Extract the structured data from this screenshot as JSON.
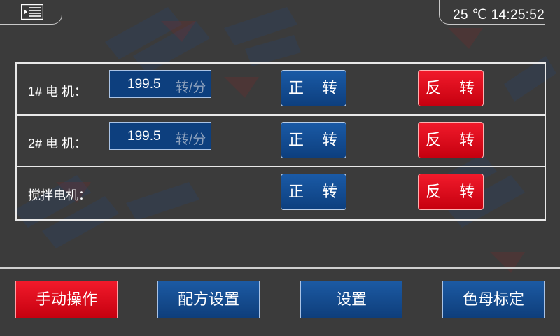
{
  "header": {
    "menu_icon": "menu-list-icon",
    "clock": "25 ℃ 14:25:52"
  },
  "motors": [
    {
      "label": "1# 电 机：",
      "speed_value": "199.5",
      "speed_unit": "转/分",
      "forward_label": "正 转",
      "reverse_label": "反 转"
    },
    {
      "label": "2# 电 机：",
      "speed_value": "199.5",
      "speed_unit": "转/分",
      "forward_label": "正 转",
      "reverse_label": "反 转"
    },
    {
      "label": "搅拌电机：",
      "forward_label": "正 转",
      "reverse_label": "反 转"
    }
  ],
  "nav": {
    "items": [
      {
        "label": "手动操作",
        "active": true
      },
      {
        "label": "配方设置",
        "active": false
      },
      {
        "label": "设置",
        "active": false
      },
      {
        "label": "色母标定",
        "active": false
      }
    ]
  },
  "colors": {
    "background": "#3b3b3b",
    "blue_button": "#0d3f7e",
    "red_button": "#e30613",
    "border": "#e8e8e8"
  }
}
